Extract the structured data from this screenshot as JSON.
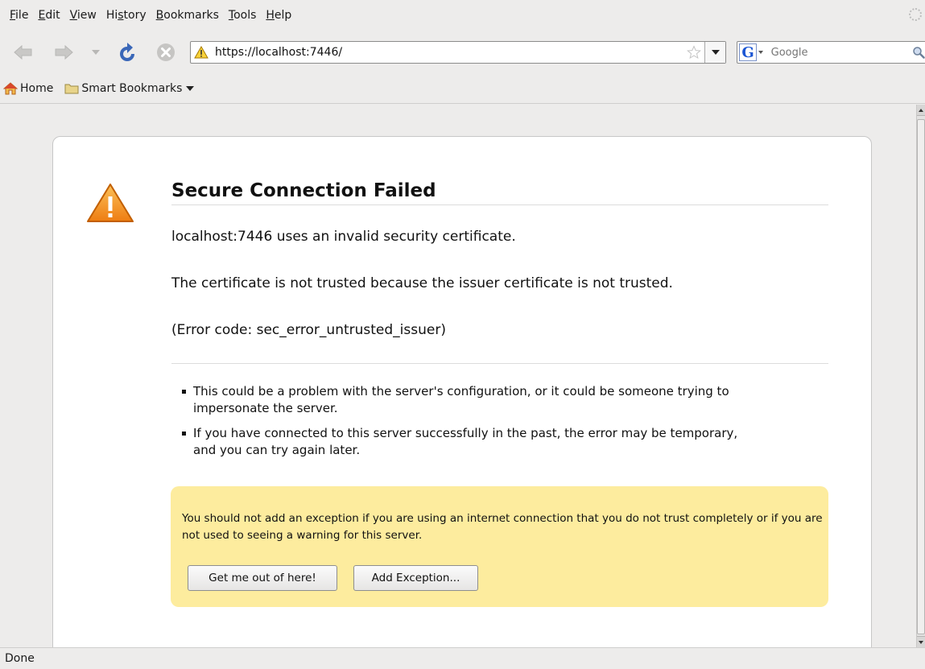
{
  "menu": {
    "items": [
      {
        "mnemonic": "F",
        "rest": "ile"
      },
      {
        "mnemonic": "E",
        "rest": "dit"
      },
      {
        "mnemonic": "V",
        "rest": "iew"
      },
      {
        "pre": "Hi",
        "mnemonic": "s",
        "rest": "tory"
      },
      {
        "mnemonic": "B",
        "rest": "ookmarks"
      },
      {
        "mnemonic": "T",
        "rest": "ools"
      },
      {
        "mnemonic": "H",
        "rest": "elp"
      }
    ]
  },
  "navbar": {
    "icons": {
      "back": "back-arrow-icon",
      "forward": "forward-arrow-icon",
      "history": "chevron-down-icon",
      "reload": "reload-icon",
      "stop": "stop-icon",
      "warning": "warning-icon",
      "star": "star-icon",
      "go": "search-icon"
    },
    "url": "https://localhost:7446/",
    "search_placeholder": "Google",
    "search_engine_letter": "G"
  },
  "bookmarks": {
    "items": [
      {
        "label": "Home",
        "icon": "home-icon"
      },
      {
        "label": "Smart Bookmarks",
        "icon": "folder-icon"
      }
    ]
  },
  "error_page": {
    "title": "Secure Connection Failed",
    "short_desc": "localhost:7446 uses an invalid security certificate.",
    "long_desc": "The certificate is not trusted because the issuer certificate is not trusted.",
    "error_code": "(Error code: sec_error_untrusted_issuer)",
    "bullets": [
      "This could be a problem with the server's configuration, or it could be someone trying to impersonate the server.",
      "If you have connected to this server successfully in the past, the error may be temporary, and you can try again later."
    ],
    "exception_text": "You should not add an exception if you are using an internet connection that you do not trust completely or if you are not used to seeing a warning for this server.",
    "buttons": {
      "get_out": "Get me out of here!",
      "add_exception": "Add Exception..."
    }
  },
  "status": {
    "text": "Done"
  },
  "colors": {
    "chrome": "#edeceb",
    "exception_panel": "#fdec9e",
    "warning_orange": "#f08c1a"
  }
}
